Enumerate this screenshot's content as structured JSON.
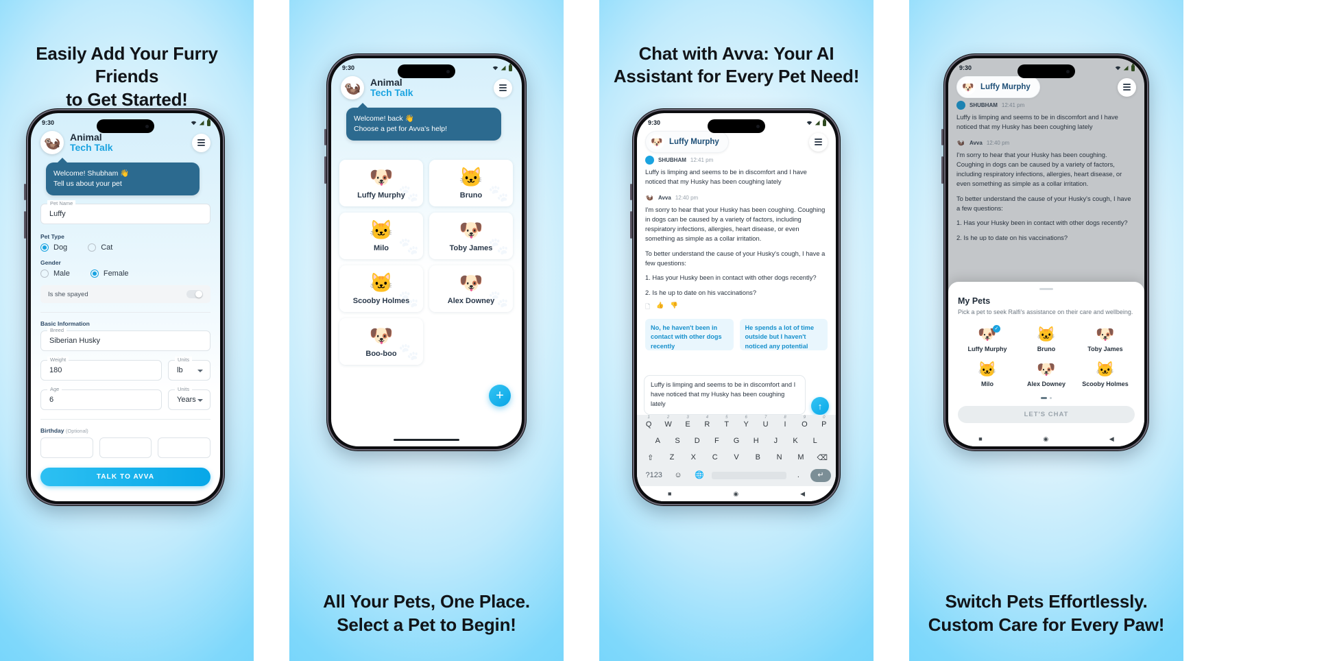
{
  "panels": [
    {
      "caption_top": "Easily Add Your Furry Friends\nto Get Started!",
      "status": {
        "time": "9:30"
      },
      "header": {
        "line1": "Animal",
        "line2": "Tech Talk",
        "avatar_icon": "raccoon-avatar",
        "menu_icon": "hamburger-menu-icon"
      },
      "bubble": {
        "line1": "Welcome! Shubham 👋",
        "line2": "Tell us about your pet"
      },
      "form": {
        "pet_name_label": "Pet Name",
        "pet_name_value": "Luffy",
        "pet_type_label": "Pet Type",
        "pet_type_options": [
          "Dog",
          "Cat"
        ],
        "pet_type_selected": "Dog",
        "gender_label": "Gender",
        "gender_options": [
          "Male",
          "Female"
        ],
        "gender_selected": "Female",
        "spayed_label": "Is she spayed",
        "spayed_on": false,
        "basic_info_label": "Basic Information",
        "breed_label": "Breed",
        "breed_value": "Siberian Husky",
        "weight_label": "Weight",
        "weight_value": "180",
        "weight_units_label": "Units",
        "weight_units_value": "lb",
        "age_label": "Age",
        "age_value": "6",
        "age_units_label": "Units",
        "age_units_value": "Years",
        "birthday_label": "Birthday",
        "birthday_optional": "(Optional)"
      },
      "cta": "TALK TO AVVA"
    },
    {
      "caption_bottom": "All Your Pets, One Place.\nSelect a Pet to Begin!",
      "status": {
        "time": "9:30"
      },
      "header": {
        "line1": "Animal",
        "line2": "Tech Talk",
        "avatar_icon": "raccoon-avatar",
        "menu_icon": "hamburger-menu-icon"
      },
      "bubble": {
        "line1": "Welcome! back 👋",
        "line2": "Choose a pet for Avva's help!"
      },
      "pets": [
        {
          "name": "Luffy Murphy",
          "emoji": "🐶"
        },
        {
          "name": "Bruno",
          "emoji": "🐱"
        },
        {
          "name": "Milo",
          "emoji": "🐱"
        },
        {
          "name": "Toby James",
          "emoji": "🐶"
        },
        {
          "name": "Scooby Holmes",
          "emoji": "🐱"
        },
        {
          "name": "Alex Downey",
          "emoji": "🐶"
        },
        {
          "name": "Boo-boo",
          "emoji": "🐶"
        }
      ],
      "fab_label": "+"
    },
    {
      "caption_top": "Chat with Avva: Your AI\nAssistant for Every Pet Need!",
      "status": {
        "time": "9:30"
      },
      "chip": {
        "name": "Luffy Murphy",
        "emoji": "🐶",
        "menu_icon": "hamburger-menu-icon"
      },
      "messages": [
        {
          "who": "SHUBHAM",
          "time": "12:41 pm",
          "self": true,
          "paragraphs": [
            "Luffy is limping and seems to be in discomfort and I have noticed that my Husky has been coughing lately"
          ]
        },
        {
          "who": "Avva",
          "time": "12:40 pm",
          "self": false,
          "paragraphs": [
            "I'm sorry to hear that your Husky has been coughing. Coughing in dogs can be caused by a variety of factors, including respiratory infections, allergies, heart disease, or even something as simple as a collar irritation.",
            "To better understand the cause of your Husky's cough, I have a few questions:",
            "1. Has your Husky been in contact with other dogs recently?",
            "2. Is he up to date on his vaccinations?"
          ],
          "reactions": [
            "🗐",
            "👍",
            "👎"
          ]
        }
      ],
      "suggestions": [
        "No, he haven't been in contact with other dogs recently",
        "He spends a lot of time outside but I haven't noticed any potential irritants or allergens"
      ],
      "composer_value": "Luffy is limping and seems to be in discomfort and I have noticed that my Husky has been coughing lately",
      "send_icon": "send-arrow-up-icon",
      "keyboard": {
        "row1": [
          "Q",
          "W",
          "E",
          "R",
          "T",
          "Y",
          "U",
          "I",
          "O",
          "P"
        ],
        "row1_nums": [
          "1",
          "2",
          "3",
          "4",
          "5",
          "6",
          "7",
          "8",
          "9",
          "0"
        ],
        "row2": [
          "A",
          "S",
          "D",
          "F",
          "G",
          "H",
          "J",
          "K",
          "L"
        ],
        "row3": [
          "⇧",
          "Z",
          "X",
          "C",
          "V",
          "B",
          "N",
          "M",
          "⌫"
        ],
        "row4": [
          "?123",
          "☺",
          "🌐",
          "",
          ".",
          "↵"
        ]
      },
      "navbar": [
        "■",
        "◉",
        "◀"
      ]
    },
    {
      "caption_bottom": "Switch Pets Effortlessly.\nCustom Care for Every Paw!",
      "status": {
        "time": "9:30"
      },
      "chip": {
        "name": "Luffy Murphy",
        "emoji": "🐶",
        "menu_icon": "hamburger-menu-icon"
      },
      "messages": [
        {
          "who": "SHUBHAM",
          "time": "12:41 pm",
          "self": true,
          "paragraphs": [
            "Luffy is limping and seems to be in discomfort and I have noticed that my Husky has been coughing lately"
          ]
        },
        {
          "who": "Avva",
          "time": "12:40 pm",
          "self": false,
          "paragraphs": [
            "I'm sorry to hear that your Husky has been coughing. Coughing in dogs can be caused by a variety of factors, including respiratory infections, allergies, heart disease, or even something as simple as a collar irritation.",
            "To better understand the cause of your Husky's cough, I have a few questions:",
            "1. Has your Husky been in contact with other dogs recently?",
            "2. Is he up to date on his vaccinations?"
          ],
          "reactions": [
            "🗐",
            "👍",
            "👎"
          ]
        }
      ],
      "sheet": {
        "title": "My Pets",
        "subtitle": "Pick a pet to seek Ralfi's assistance on their care and wellbeing.",
        "pets": [
          {
            "name": "Luffy Murphy",
            "emoji": "🐶",
            "selected": true
          },
          {
            "name": "Bruno",
            "emoji": "🐱",
            "selected": false
          },
          {
            "name": "Toby James",
            "emoji": "🐶",
            "selected": false
          },
          {
            "name": "Milo",
            "emoji": "🐱",
            "selected": false
          },
          {
            "name": "Alex Downey",
            "emoji": "🐶",
            "selected": false
          },
          {
            "name": "Scooby Holmes",
            "emoji": "🐱",
            "selected": false
          }
        ],
        "cta": "LET'S CHAT"
      },
      "navbar": [
        "■",
        "◉",
        "◀"
      ]
    }
  ],
  "colors": {
    "accent": "#1aa3e0",
    "bubble": "#2c6a8f",
    "background_top": "#ffffff",
    "background_edge": "#63d0fa",
    "suggestion_bg": "#e9f6fd",
    "suggestion_text": "#1690cc"
  }
}
